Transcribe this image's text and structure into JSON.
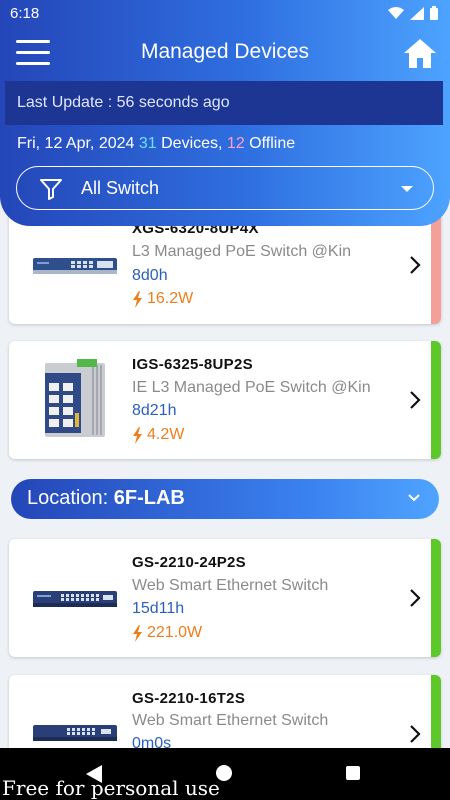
{
  "status": {
    "time": "6:18",
    "signal_icon": "wifi-icon",
    "cell_icon": "cell-signal-icon",
    "battery_icon": "battery-icon"
  },
  "header": {
    "title": "Managed Devices",
    "menu_icon": "hamburger-menu-icon",
    "home_icon": "home-icon",
    "last_update": "Last Update : 56 seconds ago",
    "date": "Fri, 12 Apr, 2024",
    "device_count": "31",
    "devices_label": "Devices,",
    "offline_count": "12",
    "offline_label": "Offline",
    "filter_label": "All Switch",
    "colors": {
      "accent": "#2f6fe0",
      "device_count": "#6ee0ff",
      "offline_count": "#ff9fd6"
    }
  },
  "devices_top": [
    {
      "name": "XGS-6320-8UP4X",
      "desc": "L3 Managed PoE   Switch @Kin",
      "uptime": "8d0h",
      "power": "16.2W",
      "status_color": "#f4a09a"
    },
    {
      "name": "IGS-6325-8UP2S",
      "desc": "IE L3 Managed PoE   Switch @Kin",
      "uptime": "8d21h",
      "power": "4.2W",
      "status_color": "#5cc82a"
    }
  ],
  "location": {
    "label": "Location:",
    "value": "6F-LAB"
  },
  "devices_bottom": [
    {
      "name": "GS-2210-24P2S",
      "desc": "Web Smart Ethernet Switch",
      "uptime": "15d11h",
      "power": "221.0W",
      "status_color": "#5cc82a"
    },
    {
      "name": "GS-2210-16T2S",
      "desc": "Web Smart Ethernet Switch",
      "uptime": "0m0s",
      "power": "",
      "status_color": "#5cc82a"
    }
  ],
  "watermark": "Free for personal use"
}
